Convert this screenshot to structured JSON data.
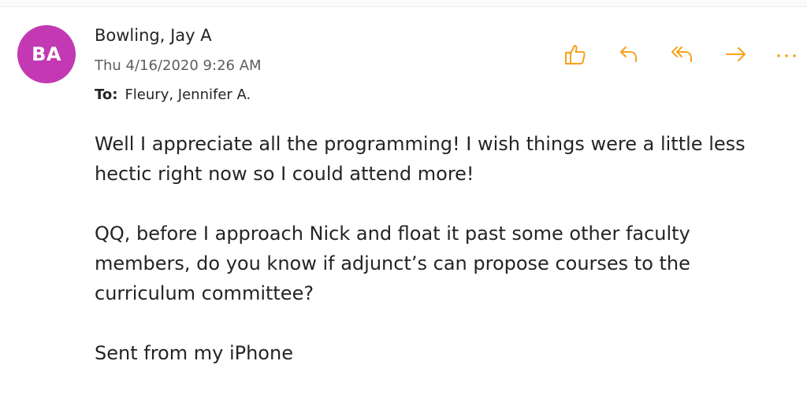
{
  "message": {
    "avatar_initials": "BA",
    "avatar_color": "#c239b3",
    "sender_name": "Bowling, Jay A",
    "date": "Thu 4/16/2020 9:26 AM",
    "to_label": "To:",
    "to_value": "Fleury, Jennifer A.",
    "body": {
      "paragraph_1": "Well I appreciate all the programming! I wish things were a little less hectic right now so I could attend more!",
      "paragraph_2": "QQ, before I approach Nick and float it past some other faculty members, do you know if adjunct’s can propose courses to the curriculum committee?",
      "signature": "Sent from my iPhone"
    }
  },
  "actions": {
    "accent_color": "#f7a11b",
    "items": [
      {
        "name": "like",
        "icon": "thumbs-up-icon"
      },
      {
        "name": "reply",
        "icon": "reply-icon"
      },
      {
        "name": "reply-all",
        "icon": "reply-all-icon"
      },
      {
        "name": "forward",
        "icon": "forward-arrow-icon"
      },
      {
        "name": "more",
        "icon": "more-ellipsis-icon"
      }
    ]
  }
}
